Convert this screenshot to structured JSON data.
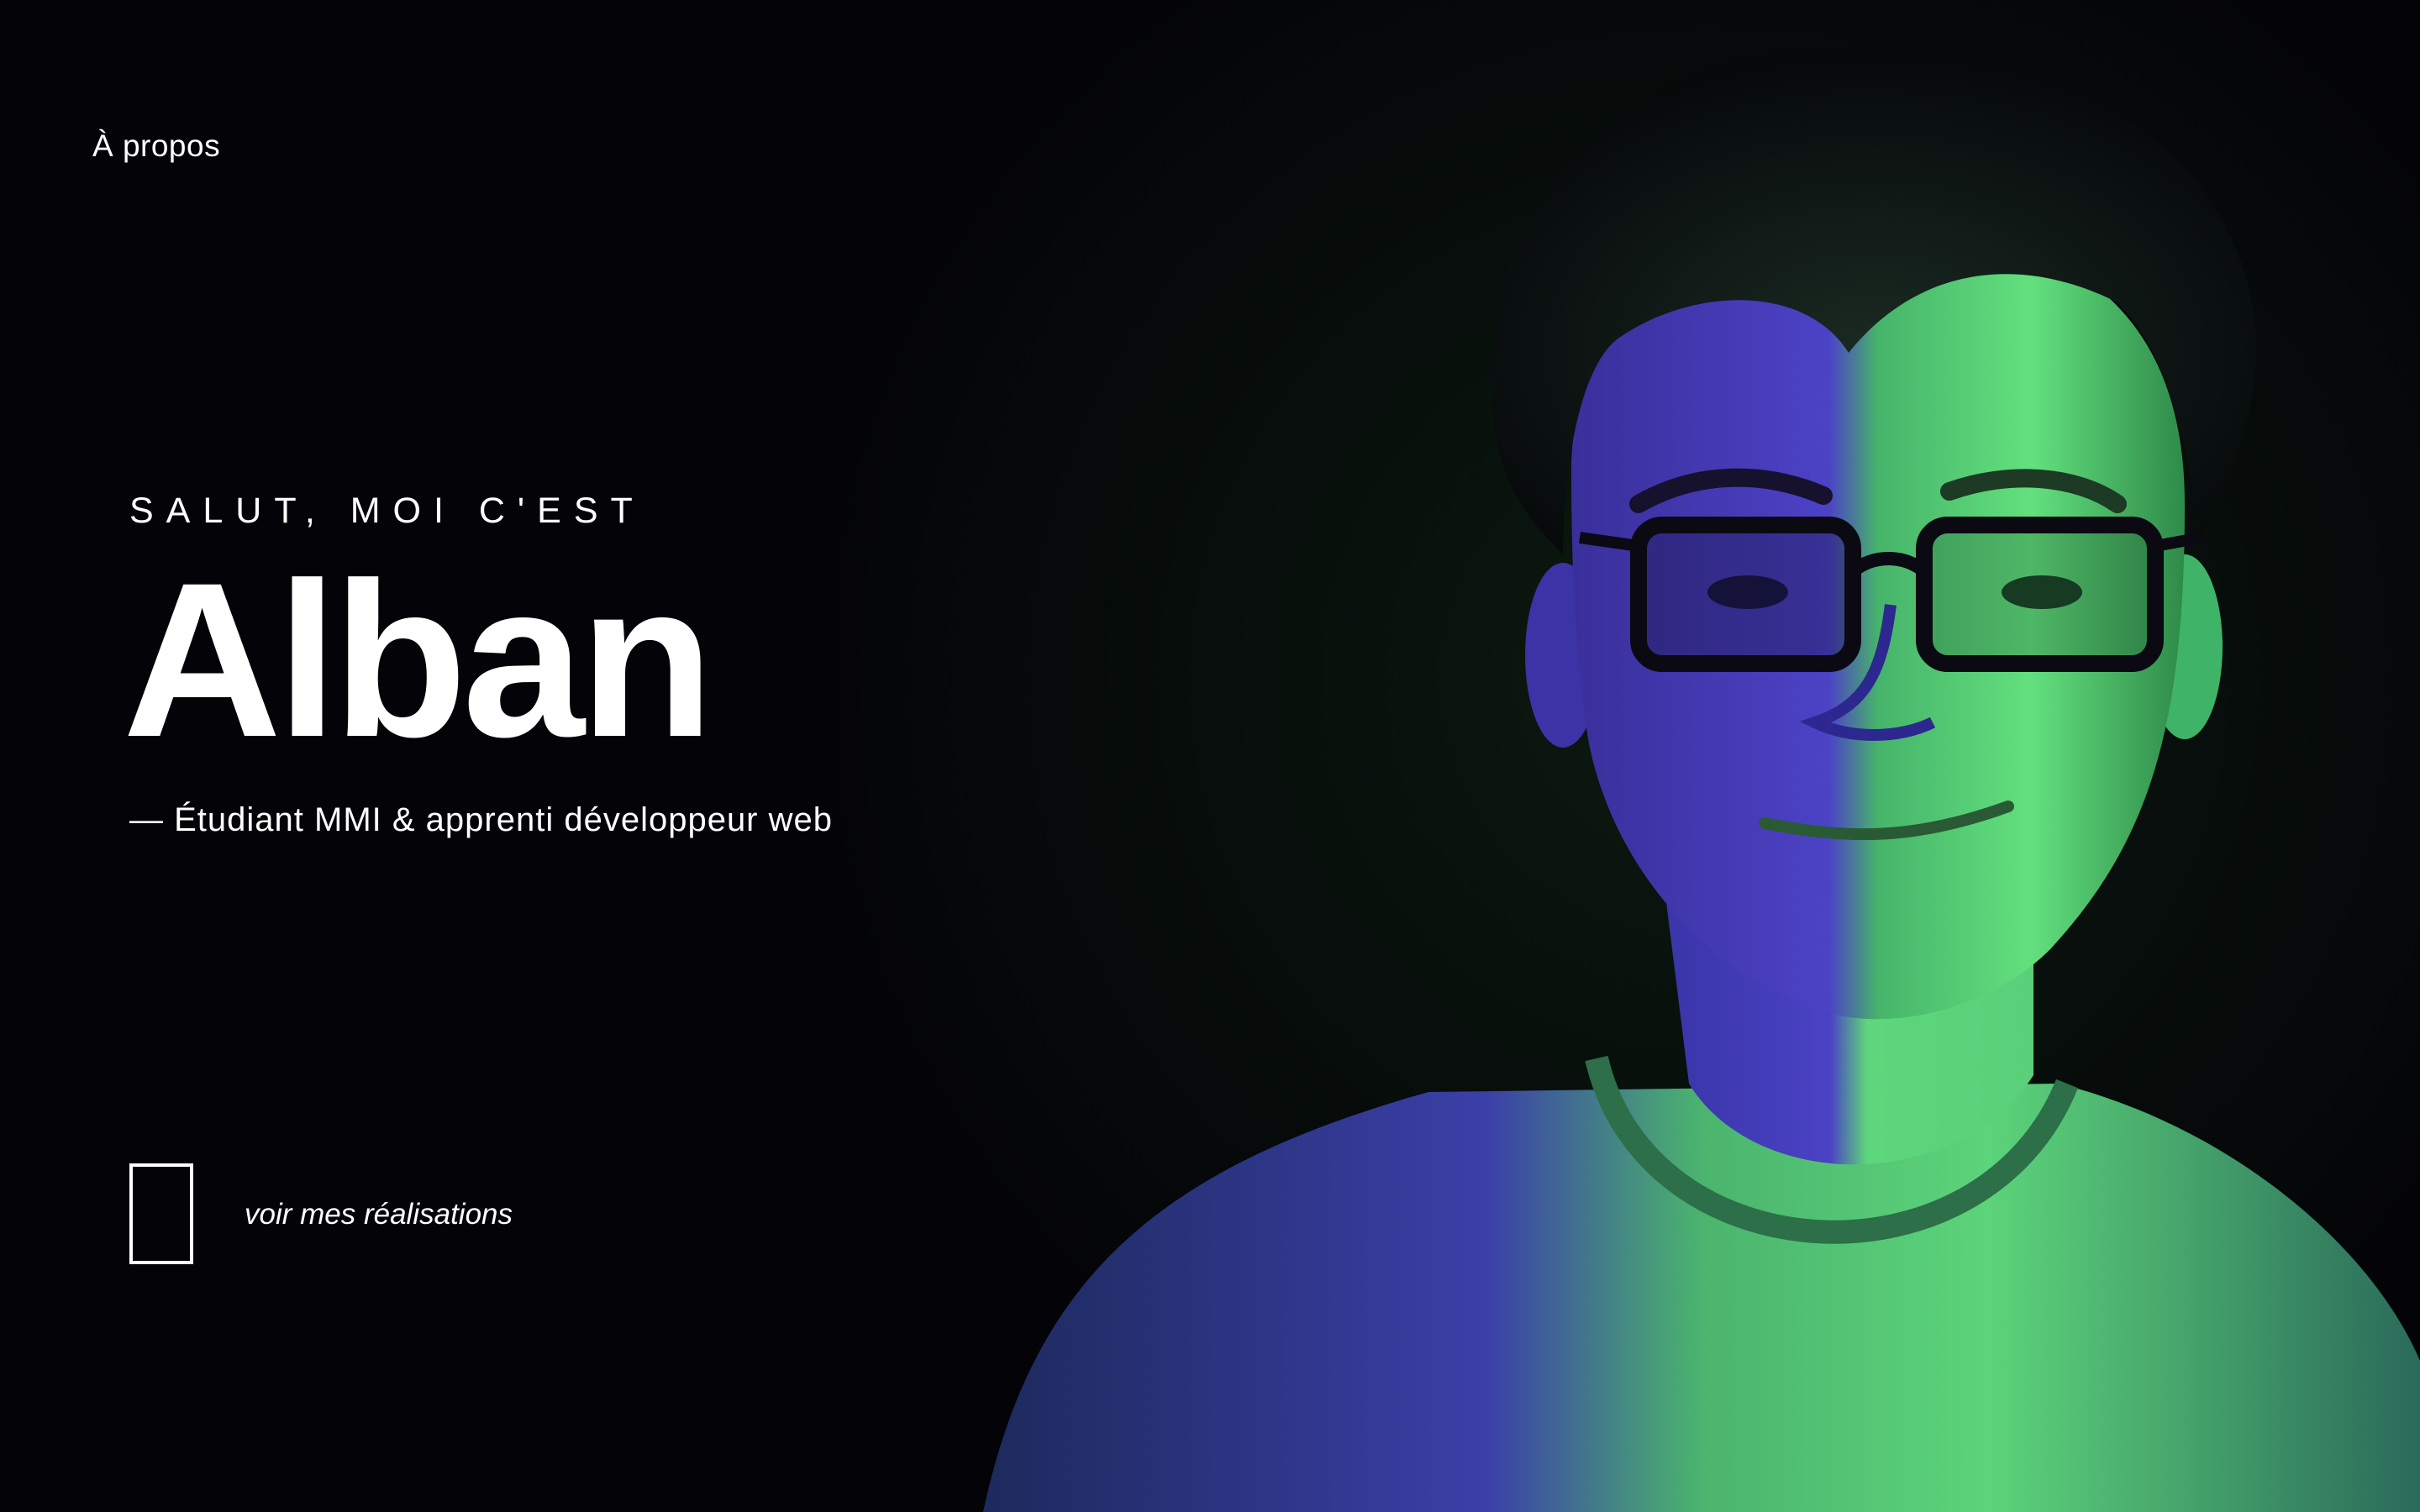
{
  "nav": {
    "about_label": "À propos"
  },
  "hero": {
    "eyebrow": "SALUT, MOI C'EST",
    "name": "Alban",
    "subtitle": "—  Étudiant MMI & apprenti développeur web"
  },
  "cta": {
    "label": "voir mes réalisations"
  },
  "colors": {
    "background": "#040307",
    "accent_green": "#5fe07a",
    "accent_violet": "#4a3fc0",
    "text": "#ffffff"
  }
}
